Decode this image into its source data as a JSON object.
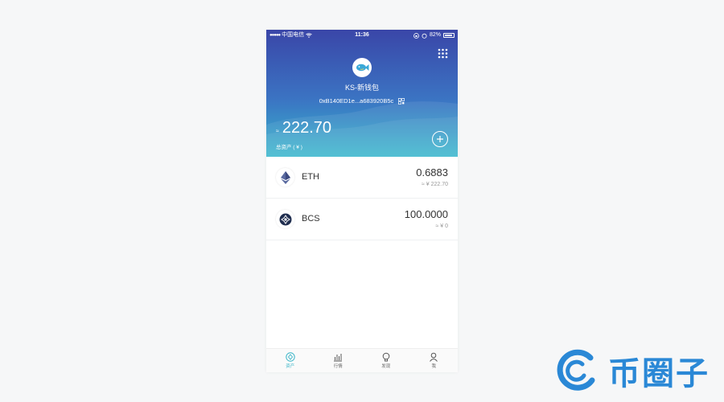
{
  "statusbar": {
    "carrier": "中国电信",
    "time": "11:36",
    "battery": "82%"
  },
  "wallet": {
    "name": "KS-新钱包",
    "address": "0xB140ED1e...a683920B5c"
  },
  "total": {
    "approx_symbol": "≈",
    "value": "222.70",
    "label": "总资产 ( ¥ )"
  },
  "assets": [
    {
      "symbol": "ETH",
      "amount": "0.6883",
      "value": "≈ ¥ 222.70",
      "icon": "eth-icon"
    },
    {
      "symbol": "BCS",
      "amount": "100.0000",
      "value": "≈ ¥ 0",
      "icon": "bcs-icon"
    }
  ],
  "tabs": [
    {
      "label": "资产",
      "icon": "asset-icon",
      "active": true
    },
    {
      "label": "行情",
      "icon": "market-chart-icon",
      "active": false
    },
    {
      "label": "发现",
      "icon": "discover-icon",
      "active": false
    },
    {
      "label": "我",
      "icon": "profile-icon",
      "active": false
    }
  ],
  "watermark": {
    "text": "币圈子"
  },
  "colors": {
    "header_top": "#3a46a8",
    "header_bottom": "#37b7cc",
    "tab_active": "#3bb5c8",
    "watermark": "#2a88d6"
  }
}
